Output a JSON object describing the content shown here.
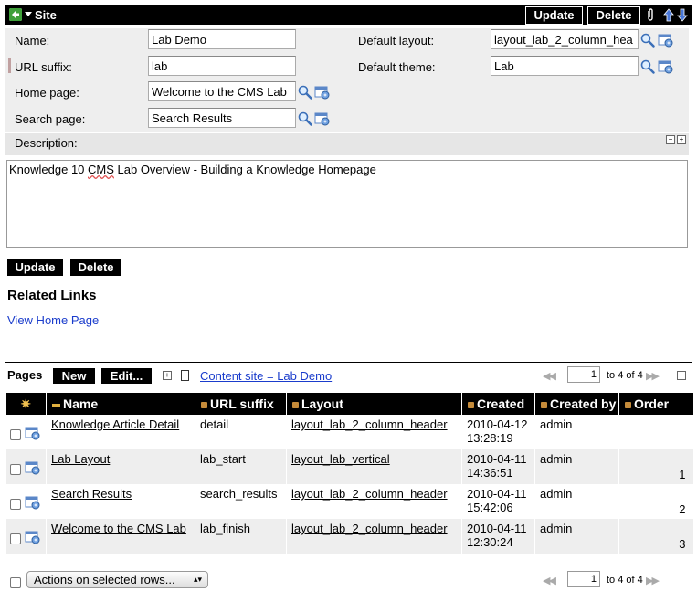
{
  "header": {
    "title": "Site",
    "update_label": "Update",
    "delete_label": "Delete"
  },
  "form": {
    "name_label": "Name:",
    "name_value": "Lab Demo",
    "url_suffix_label": "URL suffix:",
    "url_suffix_value": "lab",
    "home_page_label": "Home page:",
    "home_page_value": "Welcome to the CMS Lab",
    "search_page_label": "Search page:",
    "search_page_value": "Search Results",
    "default_layout_label": "Default layout:",
    "default_layout_value": "layout_lab_2_column_hea",
    "default_theme_label": "Default theme:",
    "default_theme_value": "Lab",
    "description_label": "Description:",
    "description_pre": "Knowledge 10 ",
    "description_cms": "CMS",
    "description_post": " Lab Overview - Building a Knowledge Homepage"
  },
  "actions": {
    "update_label": "Update",
    "delete_label": "Delete"
  },
  "related": {
    "heading": "Related Links",
    "link": "View Home Page"
  },
  "pages": {
    "label": "Pages",
    "new_label": "New",
    "edit_label": "Edit...",
    "filter_link": "Content site = Lab Demo",
    "page_value": "1",
    "page_text": "to 4 of 4",
    "columns": [
      "Name",
      "URL suffix",
      "Layout",
      "Created",
      "Created by",
      "Order"
    ],
    "rows": [
      {
        "name": "Knowledge Article Detail",
        "url_suffix": "detail",
        "layout": "layout_lab_2_column_header",
        "created_date": "2010-04-12",
        "created_time": "13:28:19",
        "created_by": "admin",
        "order": ""
      },
      {
        "name": "Lab Layout",
        "url_suffix": "lab_start",
        "layout": "layout_lab_vertical",
        "created_date": "2010-04-11",
        "created_time": "14:36:51",
        "created_by": "admin",
        "order": "1"
      },
      {
        "name": "Search Results",
        "url_suffix": "search_results",
        "layout": "layout_lab_2_column_header",
        "created_date": "2010-04-11",
        "created_time": "15:42:06",
        "created_by": "admin",
        "order": "2"
      },
      {
        "name": "Welcome to the CMS Lab",
        "url_suffix": "lab_finish",
        "layout": "layout_lab_2_column_header",
        "created_date": "2010-04-11",
        "created_time": "12:30:24",
        "created_by": "admin",
        "order": "3"
      }
    ],
    "actions_select": "Actions on selected rows...",
    "bottom_page_value": "1",
    "bottom_page_text": "to 4 of 4"
  },
  "icons": {
    "back": "back-arrow-icon",
    "paperclip": "paperclip-icon",
    "up": "arrow-up-icon",
    "down": "arrow-down-icon",
    "search": "magnifier-icon",
    "lookup": "reference-lookup-icon",
    "gear": "gear-icon"
  },
  "colors": {
    "header_bg": "#000000",
    "form_bg": "#eeeeee",
    "link": "#1a3ccc",
    "row_alt": "#eeeeee"
  }
}
